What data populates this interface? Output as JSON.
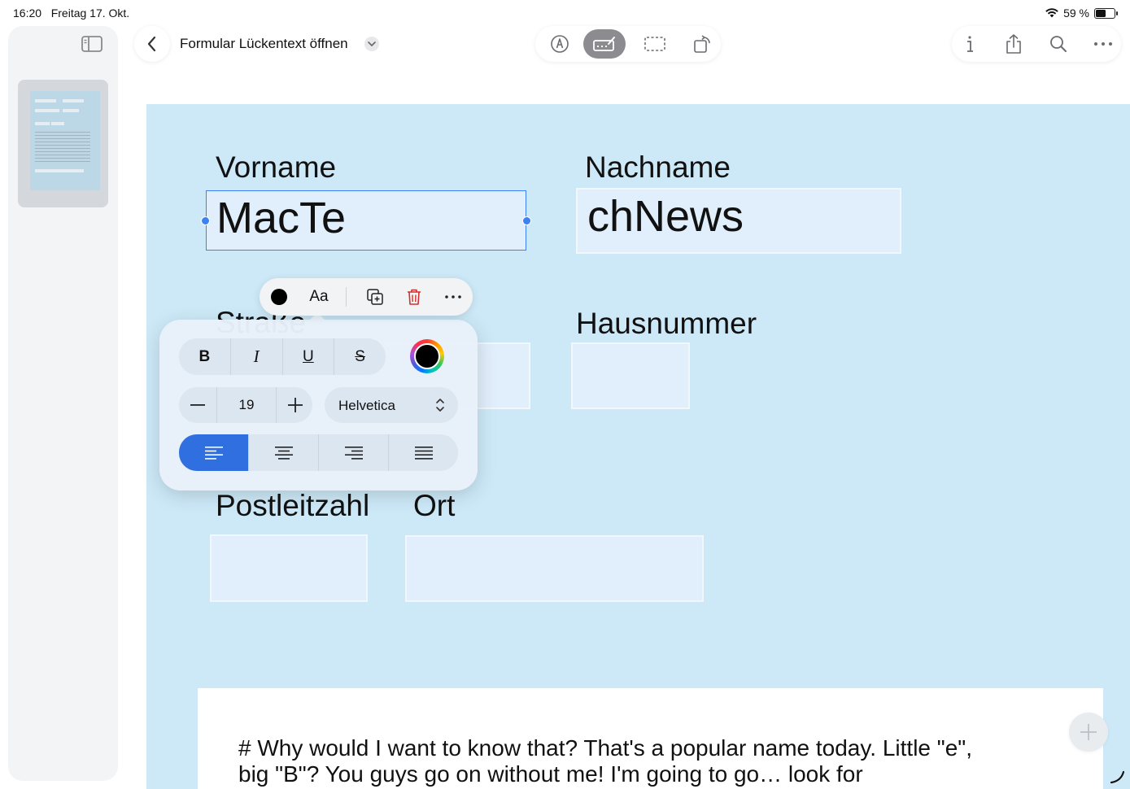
{
  "status_bar": {
    "time": "16:20",
    "date": "Freitag 17. Okt.",
    "battery_text": "59 %",
    "battery_level": 0.59
  },
  "header": {
    "title": "Formular Lückentext öffnen"
  },
  "form": {
    "vorname_label": "Vorname",
    "vorname_value": "MacTe",
    "nachname_label": "Nachname",
    "nachname_value": "chNews",
    "strasse_label": "Straße",
    "hausnummer_label": "Hausnummer",
    "plz_label": "Postleitzahl",
    "ort_label": "Ort"
  },
  "text_box": {
    "content": "# Why would I want to know that? That's a popular name today. Little \"e\", big \"B\"? You guys go on without me! I'm going to go… look for"
  },
  "context_menu": {
    "font_button": "Aa",
    "text_color": "#000000",
    "delete_color": "#d32f2f"
  },
  "format_panel": {
    "bold": "B",
    "italic": "I",
    "underline": "U",
    "strikethrough": "S",
    "font_size": "19",
    "font_name": "Helvetica",
    "selected_color": "#000000",
    "active_alignment": "left"
  },
  "colors": {
    "page_background": "#cde9f8",
    "accent": "#2f6fe0",
    "selection": "#3a82f6"
  }
}
